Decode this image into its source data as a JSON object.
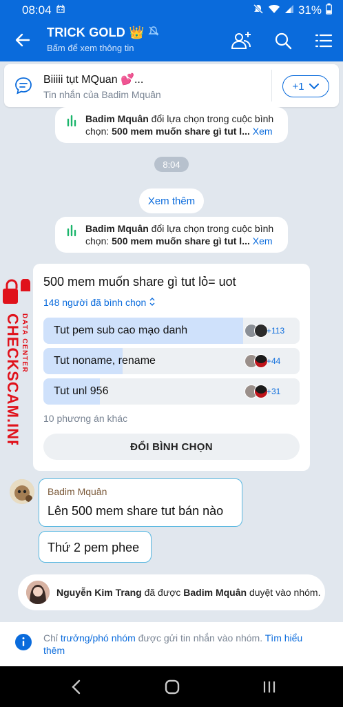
{
  "status_bar": {
    "time": "08:04",
    "battery": "31%"
  },
  "header": {
    "title": "TRICK GOLD",
    "crown": "👑",
    "subtitle": "Bấm để xem thông tin"
  },
  "pinned": {
    "title": "Biiiii tụt MQuan 💕...",
    "subtitle": "Tin nhắn của Badim Mquân",
    "more_label": "+1"
  },
  "notices": [
    {
      "actor": "Badim Mquân",
      "text": " đổi lựa chọn trong cuộc bình chọn: ",
      "poll": "500 mem muốn share gì tut l...",
      "link": " Xem"
    },
    {
      "actor": "Badim Mquân",
      "text": " đổi lựa chọn trong cuộc bình chọn: ",
      "poll": "500 mem muốn share gì tut l...",
      "link": " Xem"
    }
  ],
  "time_chip": "8:04",
  "see_more": "Xem thêm",
  "poll": {
    "question": "500 mem muốn share gì tut lỏ= uot",
    "voters": "148 người đã bình chọn",
    "options": [
      {
        "label": "Tut pem sub cao mạo danh",
        "count": "+113",
        "fraction": 0.78
      },
      {
        "label": "Tut noname, rename",
        "count": "+44",
        "fraction": 0.31
      },
      {
        "label": "Tut unl 956",
        "count": "+31",
        "fraction": 0.22
      }
    ],
    "other": "10 phương án khác",
    "button": "ĐỔI BÌNH CHỌN"
  },
  "watermark": {
    "line1": "DATA CENTER",
    "line2": "CHECKSCAM.INFO"
  },
  "messages": [
    {
      "sender": "Badim Mquân",
      "text": "Lên 500 mem share tut bán nào"
    },
    {
      "text": "Thứ 2 pem phee"
    }
  ],
  "join": {
    "member": "Nguyễn Kim Trang",
    "middle": " đã được ",
    "approver": "Badim Mquân",
    "tail": " duyệt vào nhóm."
  },
  "info": {
    "prefix": "Chỉ ",
    "role": "trưởng/phó nhóm",
    "middle": " được gửi tin nhắn vào nhóm. ",
    "link": "Tìm hiểu thêm"
  },
  "colors": {
    "brand": "#0a6bdc",
    "background": "#e1e7ee",
    "watermark": "#e0121b"
  }
}
